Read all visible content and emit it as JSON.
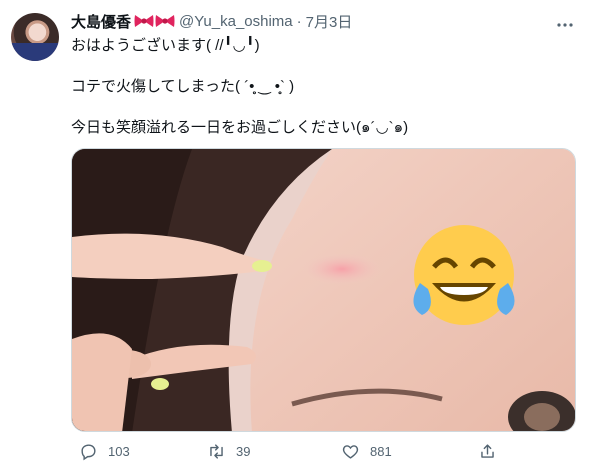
{
  "tweet": {
    "author_name": "大島優香",
    "handle": "@Yu_ka_oshima",
    "separator": "·",
    "date": "7月3日",
    "lines": [
      "おはようございます( //╹◡╹)",
      "コテで火傷してしまった( ´•̥̥̥ ‿ •̥̥̥` )",
      "今日も笑顔溢れる一日をお過ごしください(๑´◡`๑)"
    ]
  },
  "media": {
    "alt_icon": "face-with-tears-of-joy-emoji"
  },
  "actions": {
    "reply_count": "103",
    "retweet_count": "39",
    "like_count": "881"
  },
  "icons": [
    "ribbon-bow-icon",
    "more-icon",
    "reply-icon",
    "retweet-icon",
    "like-icon",
    "share-icon"
  ]
}
